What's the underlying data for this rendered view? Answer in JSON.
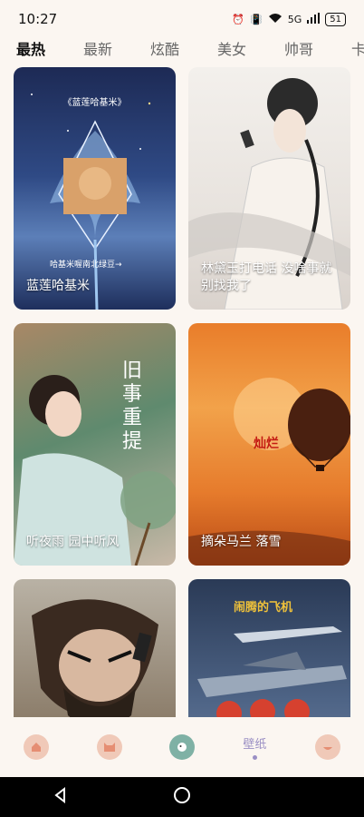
{
  "status": {
    "time": "10:27",
    "network": "5G",
    "battery": "51"
  },
  "tabs": [
    "最热",
    "最新",
    "炫酷",
    "美女",
    "帅哥",
    "卡通"
  ],
  "cards": [
    {
      "label": "蓝莲哈基米",
      "top_text": "《蓝莲哈基米》",
      "bottom_text": "哈基米喔南北绿豆→"
    },
    {
      "label": "林黛玉打电话 没啥事就别找我了"
    },
    {
      "label": "听夜雨 园中听风",
      "overlay_text": "旧事重提"
    },
    {
      "label": "摘朵马兰 落雪",
      "overlay_text": "灿烂"
    },
    {
      "label": ""
    },
    {
      "label": "",
      "overlay_text": "闹腾的飞机"
    }
  ],
  "nav": {
    "wallpaper_label": "壁纸",
    "colors": {
      "home": "#f0c9b8",
      "cat": "#f0c9b8",
      "dog": "#7fb1a5",
      "face": "#f0c9b8"
    }
  }
}
